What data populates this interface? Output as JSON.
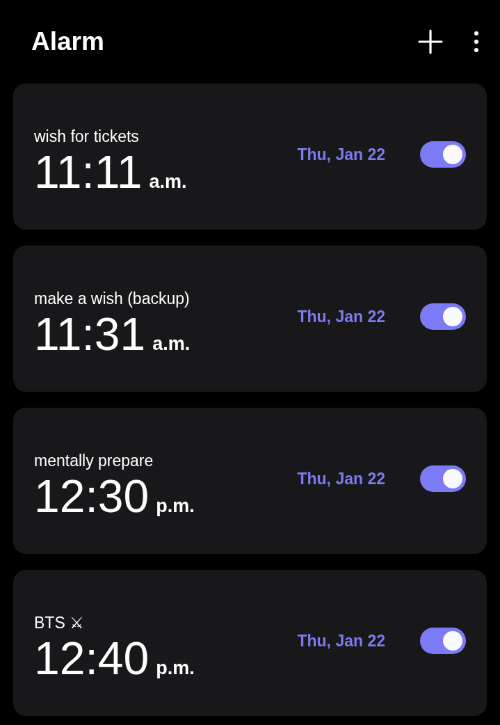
{
  "header": {
    "title": "Alarm"
  },
  "alarms": [
    {
      "label": "wish for tickets",
      "time": "11:11",
      "period": "a.m.",
      "date": "Thu, Jan 22",
      "on": true
    },
    {
      "label": "make a wish (backup)",
      "time": "11:31",
      "period": "a.m.",
      "date": "Thu, Jan 22",
      "on": true
    },
    {
      "label": "mentally prepare",
      "time": "12:30",
      "period": "p.m.",
      "date": "Thu, Jan 22",
      "on": true
    },
    {
      "label": "BTS ⚔",
      "time": "12:40",
      "period": "p.m.",
      "date": "Thu, Jan 22",
      "on": true
    }
  ]
}
